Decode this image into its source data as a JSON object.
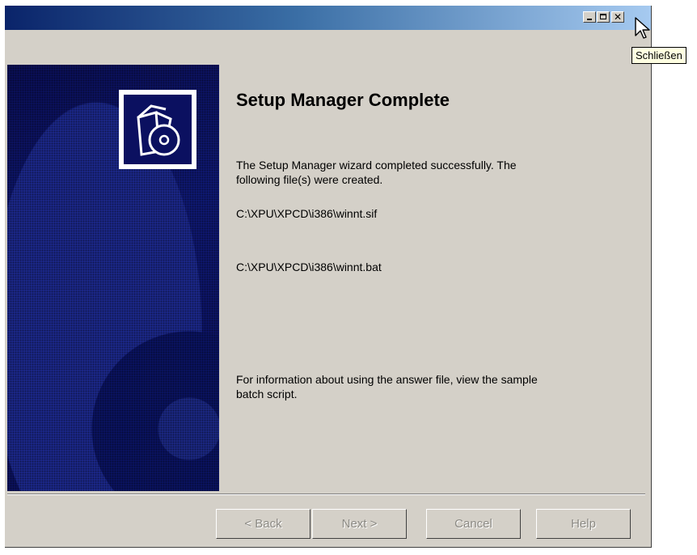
{
  "window": {
    "title_buttons": {
      "minimize": "_",
      "maximize": "□",
      "close": "✕"
    }
  },
  "tooltip": {
    "text": "Schließen"
  },
  "wizard": {
    "title": "Setup Manager Complete",
    "message_line1": "The Setup Manager wizard completed successfully. The",
    "message_line2": "following file(s) were created.",
    "file1": "C:\\XPU\\XPCD\\i386\\winnt.sif",
    "file2": "C:\\XPU\\XPCD\\i386\\winnt.bat",
    "info_line1": "For information about using the answer file, view the sample",
    "info_line2": "batch script."
  },
  "buttons": {
    "back": "< Back",
    "next": "Next >",
    "cancel": "Cancel",
    "help": "Help"
  },
  "icons": {
    "wizard_logo": "setup-box-cd-icon",
    "cursor": "mouse-pointer-icon"
  }
}
